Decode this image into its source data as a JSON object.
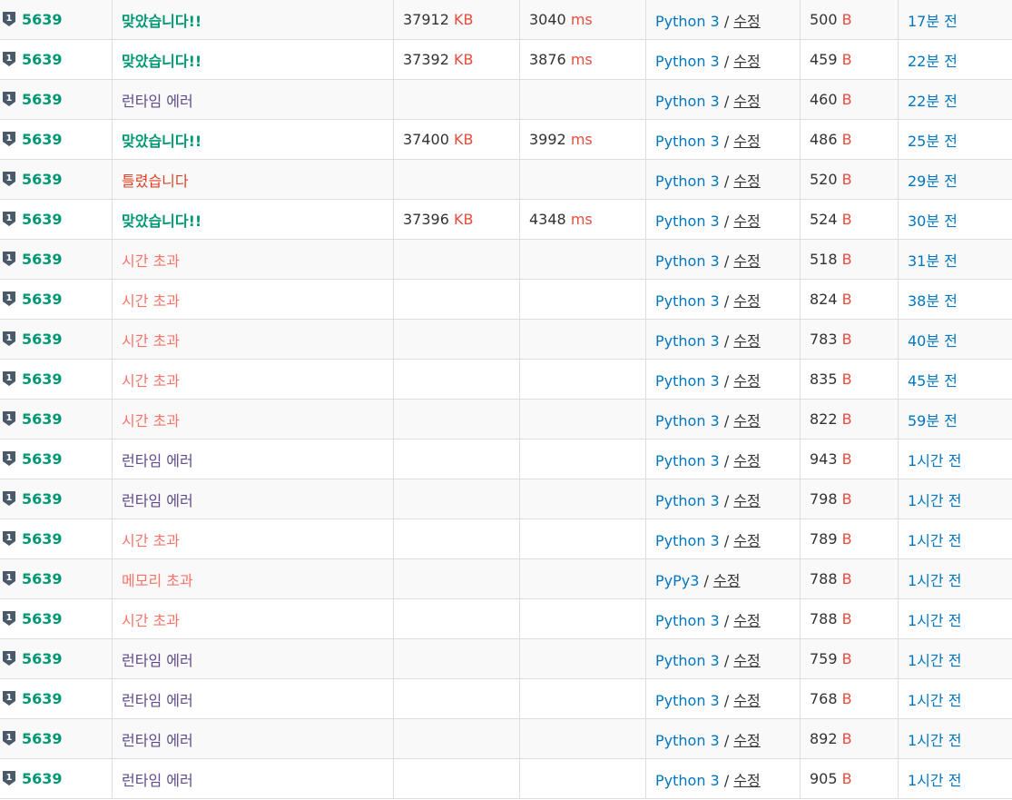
{
  "table": {
    "unit_kb": "KB",
    "unit_ms": "ms",
    "unit_b": "B",
    "edit_label": "수정",
    "lang_sep": " / ",
    "tier_icon": "bronze-tier-1-icon",
    "tier_level": "1",
    "colors": {
      "accepted": "#009874",
      "wrong": "#dd4124",
      "time_limit": "#fa7268",
      "runtime_error": "#5f4b8b",
      "link": "#0076c0",
      "unit": "#e74c3c"
    },
    "rows": [
      {
        "problem": "5639",
        "result": "맞았습니다!!",
        "result_type": "ac",
        "memory": "37912",
        "time": "3040",
        "language": "Python 3",
        "code_length": "500",
        "submitted": "17분 전"
      },
      {
        "problem": "5639",
        "result": "맞았습니다!!",
        "result_type": "ac",
        "memory": "37392",
        "time": "3876",
        "language": "Python 3",
        "code_length": "459",
        "submitted": "22분 전"
      },
      {
        "problem": "5639",
        "result": "런타임 에러",
        "result_type": "rte",
        "memory": "",
        "time": "",
        "language": "Python 3",
        "code_length": "460",
        "submitted": "22분 전"
      },
      {
        "problem": "5639",
        "result": "맞았습니다!!",
        "result_type": "ac",
        "memory": "37400",
        "time": "3992",
        "language": "Python 3",
        "code_length": "486",
        "submitted": "25분 전"
      },
      {
        "problem": "5639",
        "result": "틀렸습니다",
        "result_type": "wa",
        "memory": "",
        "time": "",
        "language": "Python 3",
        "code_length": "520",
        "submitted": "29분 전"
      },
      {
        "problem": "5639",
        "result": "맞았습니다!!",
        "result_type": "ac",
        "memory": "37396",
        "time": "4348",
        "language": "Python 3",
        "code_length": "524",
        "submitted": "30분 전"
      },
      {
        "problem": "5639",
        "result": "시간 초과",
        "result_type": "tle",
        "memory": "",
        "time": "",
        "language": "Python 3",
        "code_length": "518",
        "submitted": "31분 전"
      },
      {
        "problem": "5639",
        "result": "시간 초과",
        "result_type": "tle",
        "memory": "",
        "time": "",
        "language": "Python 3",
        "code_length": "824",
        "submitted": "38분 전"
      },
      {
        "problem": "5639",
        "result": "시간 초과",
        "result_type": "tle",
        "memory": "",
        "time": "",
        "language": "Python 3",
        "code_length": "783",
        "submitted": "40분 전"
      },
      {
        "problem": "5639",
        "result": "시간 초과",
        "result_type": "tle",
        "memory": "",
        "time": "",
        "language": "Python 3",
        "code_length": "835",
        "submitted": "45분 전"
      },
      {
        "problem": "5639",
        "result": "시간 초과",
        "result_type": "tle",
        "memory": "",
        "time": "",
        "language": "Python 3",
        "code_length": "822",
        "submitted": "59분 전"
      },
      {
        "problem": "5639",
        "result": "런타임 에러",
        "result_type": "rte",
        "memory": "",
        "time": "",
        "language": "Python 3",
        "code_length": "943",
        "submitted": "1시간 전"
      },
      {
        "problem": "5639",
        "result": "런타임 에러",
        "result_type": "rte",
        "memory": "",
        "time": "",
        "language": "Python 3",
        "code_length": "798",
        "submitted": "1시간 전"
      },
      {
        "problem": "5639",
        "result": "시간 초과",
        "result_type": "tle",
        "memory": "",
        "time": "",
        "language": "Python 3",
        "code_length": "789",
        "submitted": "1시간 전"
      },
      {
        "problem": "5639",
        "result": "메모리 초과",
        "result_type": "mle",
        "memory": "",
        "time": "",
        "language": "PyPy3",
        "code_length": "788",
        "submitted": "1시간 전"
      },
      {
        "problem": "5639",
        "result": "시간 초과",
        "result_type": "tle",
        "memory": "",
        "time": "",
        "language": "Python 3",
        "code_length": "788",
        "submitted": "1시간 전"
      },
      {
        "problem": "5639",
        "result": "런타임 에러",
        "result_type": "rte",
        "memory": "",
        "time": "",
        "language": "Python 3",
        "code_length": "759",
        "submitted": "1시간 전"
      },
      {
        "problem": "5639",
        "result": "런타임 에러",
        "result_type": "rte",
        "memory": "",
        "time": "",
        "language": "Python 3",
        "code_length": "768",
        "submitted": "1시간 전"
      },
      {
        "problem": "5639",
        "result": "런타임 에러",
        "result_type": "rte",
        "memory": "",
        "time": "",
        "language": "Python 3",
        "code_length": "892",
        "submitted": "1시간 전"
      },
      {
        "problem": "5639",
        "result": "런타임 에러",
        "result_type": "rte",
        "memory": "",
        "time": "",
        "language": "Python 3",
        "code_length": "905",
        "submitted": "1시간 전"
      }
    ]
  }
}
